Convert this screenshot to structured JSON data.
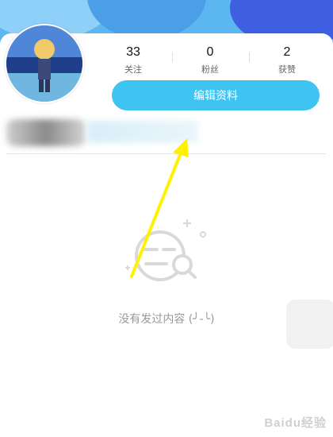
{
  "profile": {
    "stats": [
      {
        "value": "33",
        "label": "关注"
      },
      {
        "value": "0",
        "label": "粉丝"
      },
      {
        "value": "2",
        "label": "获赞"
      }
    ],
    "edit_button_label": "编辑资料"
  },
  "content": {
    "empty_text": "没有发过内容 (╯-╰)"
  },
  "watermark": {
    "text": "Baidu经验"
  },
  "colors": {
    "accent": "#3fc4f2",
    "arrow": "#fff200"
  }
}
